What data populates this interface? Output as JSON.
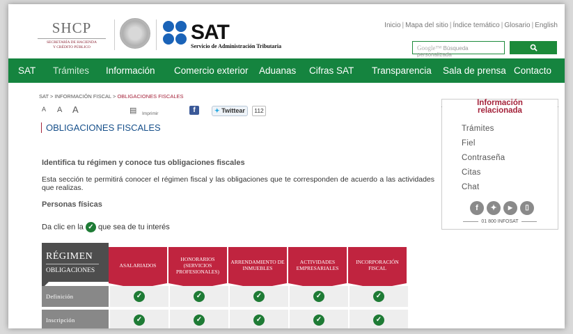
{
  "header": {
    "shcp": {
      "big": "SHCP",
      "line1": "SECRETARÍA DE HACIENDA",
      "line2": "Y CRÉDITO PÚBLICO"
    },
    "sat": {
      "wordmark": "SAT",
      "subtitle": "Servicio de Administración Tributaria"
    },
    "top_links": [
      "Inicio",
      "Mapa del sitio",
      "Índice temático",
      "Glosario",
      "English"
    ],
    "search": {
      "google_label": "Google™",
      "placeholder": "Búsqueda personalizada"
    },
    "brand_green": "#15843f"
  },
  "nav": {
    "items": [
      "SAT",
      "Trámites",
      "Información",
      "Comercio exterior",
      "Aduanas",
      "Cifras SAT",
      "Transparencia",
      "Sala de prensa",
      "Contacto"
    ],
    "active": "Trámites"
  },
  "breadcrumb": {
    "p1": "SAT",
    "sep": ">",
    "p2": "INFORMACIÓN FISCAL",
    "p3": "OBLIGACIONES FISCALES"
  },
  "tools": {
    "print_label": "Imprimir",
    "twitter_label": "Twittear",
    "twitter_count": "112"
  },
  "page_title": "OBLIGACIONES FISCALES",
  "intro": {
    "heading": "Identifica tu régimen y conoce tus obligaciones fiscales",
    "text": "Esta sección te permitirá conocer el régimen fiscal y las obligaciones que te corresponden de acuerdo a las actividades que realizas.",
    "section": "Personas físicas",
    "hint_before": "Da clic en la",
    "hint_after": "que sea de tu interés"
  },
  "table": {
    "corner_top": "RÉGIMEN",
    "corner_bottom": "OBLIGACIONES",
    "columns": [
      "ASALARIADOS",
      "HONORARIOS (SERVICIOS PROFESIONALES)",
      "ARRENDAMIENTO DE INMUEBLES",
      "ACTIVIDADES EMPRESARIALES",
      "INCORPORACIÓN FISCAL"
    ],
    "rows": [
      "Definición",
      "Inscripción"
    ],
    "accent": "#c0243f"
  },
  "sidebar": {
    "title_line1": "Información",
    "title_line2": "relacionada",
    "links": [
      "Trámites",
      "Fiel",
      "Contraseña",
      "Citas",
      "Chat"
    ],
    "social": [
      "facebook-icon",
      "twitter-icon",
      "youtube-icon",
      "mobile-app-icon"
    ],
    "phone": "01 800 INFOSAT"
  }
}
